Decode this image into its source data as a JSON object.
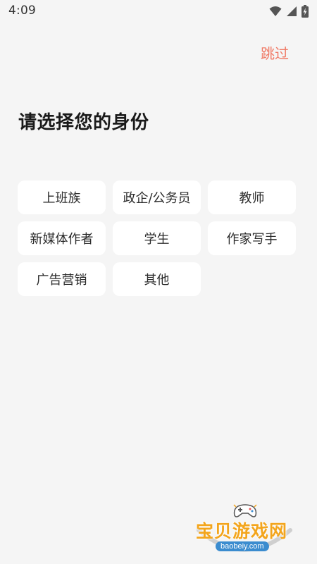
{
  "status_bar": {
    "time": "4:09",
    "icons": [
      "wifi-icon",
      "cellular-signal-icon",
      "battery-charging-icon"
    ]
  },
  "header": {
    "skip_label": "跳过"
  },
  "main": {
    "title": "请选择您的身份",
    "options": [
      {
        "label": "上班族"
      },
      {
        "label": "政企/公务员"
      },
      {
        "label": "教师"
      },
      {
        "label": "新媒体作者"
      },
      {
        "label": "学生"
      },
      {
        "label": "作家写手"
      },
      {
        "label": "广告营销"
      },
      {
        "label": "其他"
      }
    ]
  },
  "watermark": {
    "brand_text": "宝贝游戏网",
    "domain": "baobeiy.com"
  },
  "colors": {
    "background": "#f5f5f5",
    "skip": "#f07a66",
    "option_bg": "#ffffff",
    "watermark_text": "#f3a51c",
    "watermark_badge": "#3b8ccf"
  }
}
